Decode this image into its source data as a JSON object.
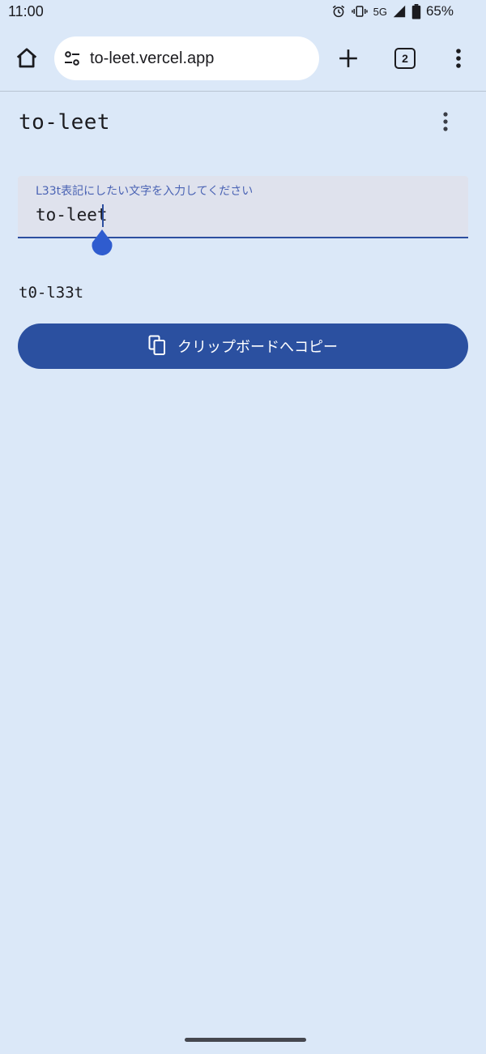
{
  "status_bar": {
    "time": "11:00",
    "network": "5G",
    "battery": "65%",
    "icons": [
      "alarm-icon",
      "vibrate-icon",
      "signal-icon",
      "battery-icon"
    ]
  },
  "browser": {
    "url": "to-leet.vercel.app",
    "tab_count": "2",
    "icons": [
      "home-icon",
      "site-settings-icon",
      "plus-icon",
      "more-vert-icon"
    ]
  },
  "app": {
    "title": "to-leet",
    "input": {
      "label": "L33t表記にしたい文字を入力してください",
      "value": "to-leet"
    },
    "result": "t0-l33t",
    "copy_button": {
      "label": "クリップボードへコピー",
      "icon": "copy-icon"
    }
  },
  "colors": {
    "background": "#dbe8f8",
    "accent": "#2b50a0",
    "field_background": "#dfe2ed",
    "label": "#4a63b4"
  }
}
